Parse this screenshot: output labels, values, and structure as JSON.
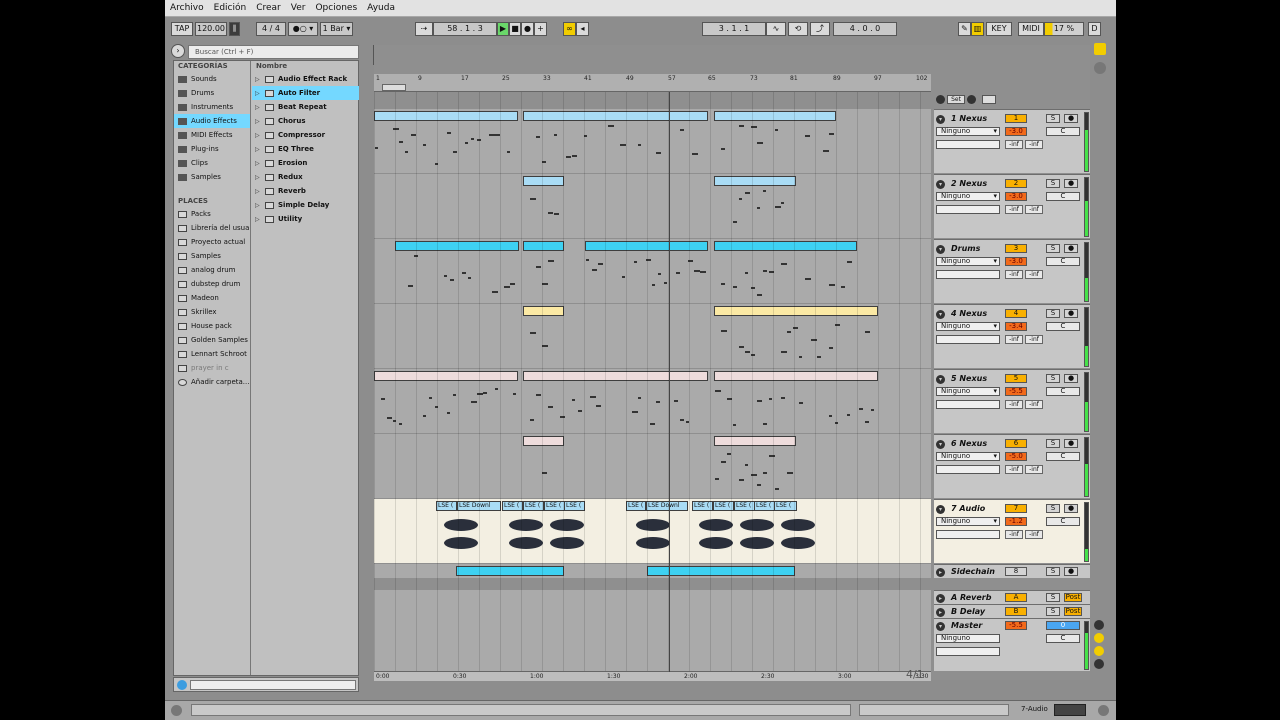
{
  "menu": [
    "Archivo",
    "Edición",
    "Crear",
    "Ver",
    "Opciones",
    "Ayuda"
  ],
  "transport": {
    "tap": "TAP",
    "tempo": "120.00",
    "signature_num": "4",
    "signature_den": "4",
    "quantize": "1 Bar",
    "position": "58 .  1 .  3",
    "loop_start": "3 .  1 .  1",
    "loop_length": "4 .  0 .  0",
    "key": "KEY",
    "midi": "MIDI",
    "cpu": "17 %",
    "d": "D"
  },
  "search": {
    "placeholder": "Buscar (Ctrl + F)"
  },
  "browser": {
    "categories_header": "CATEGORÍAS",
    "categories": [
      "Sounds",
      "Drums",
      "Instruments",
      "Audio Effects",
      "MIDI Effects",
      "Plug-ins",
      "Clips",
      "Samples"
    ],
    "selected_category": "Audio Effects",
    "places_header": "PLACES",
    "places": [
      "Packs",
      "Librería del usua",
      "Proyecto actual",
      "Samples",
      "analog drum",
      "dubstep drum",
      "Madeon",
      "Skrillex",
      "House pack",
      "Golden Samples",
      "Lennart Schroot",
      "prayer in c",
      "Añadir carpeta..."
    ],
    "name_header": "Nombre",
    "items": [
      "Audio Effect Rack",
      "Auto Filter",
      "Beat Repeat",
      "Chorus",
      "Compressor",
      "EQ Three",
      "Erosion",
      "Redux",
      "Reverb",
      "Simple Delay",
      "Utility"
    ],
    "selected_item": "Auto Filter"
  },
  "ruler": [
    "1",
    "9",
    "17",
    "25",
    "33",
    "41",
    "49",
    "57",
    "65",
    "73",
    "81",
    "89",
    "97",
    "102"
  ],
  "set_label": "Set",
  "time_ruler": [
    "0:00",
    "0:30",
    "1:00",
    "1:30",
    "2:00",
    "2:30",
    "3:00",
    "3:30"
  ],
  "zoom_label": "4/1",
  "tracks": [
    {
      "name": "1 Nexus",
      "num": "1",
      "input": "Ninguno",
      "vol": "-3.0",
      "pan": "C",
      "inf1": "-inf",
      "inf2": "-inf",
      "level": 0.7
    },
    {
      "name": "2 Nexus",
      "num": "2",
      "input": "Ninguno",
      "vol": "-3.0",
      "pan": "C",
      "inf1": "-inf",
      "inf2": "-inf",
      "level": 0.6
    },
    {
      "name": "Drums",
      "num": "3",
      "input": "Ninguno",
      "vol": "-3.0",
      "pan": "C",
      "inf1": "-inf",
      "inf2": "-inf",
      "level": 0.4
    },
    {
      "name": "4 Nexus",
      "num": "4",
      "input": "Ninguno",
      "vol": "-3.4",
      "pan": "C",
      "inf1": "-inf",
      "inf2": "-inf",
      "level": 0.35
    },
    {
      "name": "5 Nexus",
      "num": "5",
      "input": "Ninguno",
      "vol": "-5.5",
      "pan": "C",
      "inf1": "-inf",
      "inf2": "-inf",
      "level": 0.5
    },
    {
      "name": "6 Nexus",
      "num": "6",
      "input": "Ninguno",
      "vol": "-5.0",
      "pan": "C",
      "inf1": "-inf",
      "inf2": "-inf",
      "level": 0.55
    },
    {
      "name": "7 Audio",
      "num": "7",
      "input": "Ninguno",
      "vol": "-1.2",
      "pan": "C",
      "inf1": "-inf",
      "inf2": "-inf",
      "level": 0.2
    }
  ],
  "sidechain": {
    "name": "Sidechain",
    "num": "8"
  },
  "returns": [
    {
      "name": "A Reverb",
      "num": "A",
      "post": "Post"
    },
    {
      "name": "B Delay",
      "num": "B",
      "post": "Post"
    }
  ],
  "master": {
    "name": "Master",
    "input": "Ninguno",
    "vol": "-5.5",
    "num": "0",
    "pan": "C"
  },
  "audio_clip_labels": [
    "LSE (",
    "LSE Downl",
    "LSE (",
    "LSE (",
    "LSE (",
    "LSE (",
    "LSE (",
    "LSE Downl",
    "LSE (",
    "LSE (",
    "LSE (",
    "LSE (",
    "LSE ("
  ],
  "status": {
    "track": "7-Audio"
  },
  "colors": {
    "blue": "#a9dcf5",
    "cyan": "#3ed1f2",
    "yellow": "#fbe9a4",
    "pink": "#eedcdc",
    "accent": "#f9b000"
  }
}
